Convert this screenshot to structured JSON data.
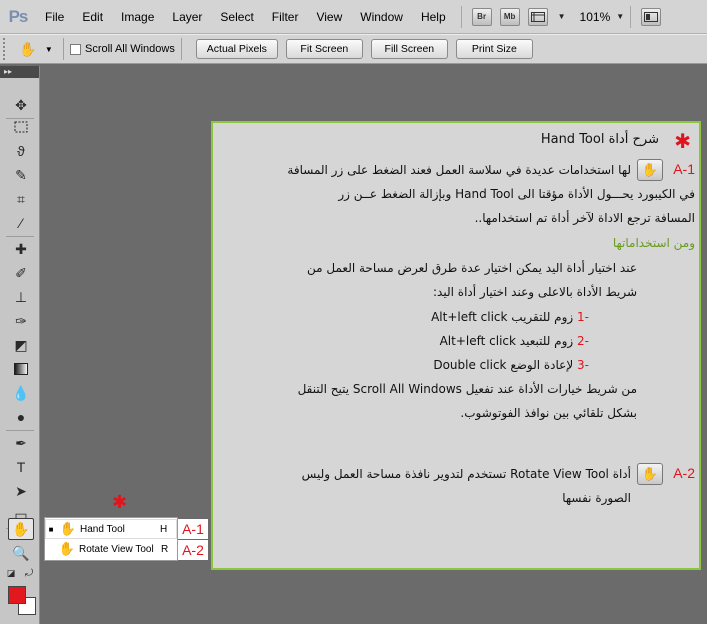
{
  "app": {
    "logo": "Ps"
  },
  "menu": [
    "File",
    "Edit",
    "Image",
    "Layer",
    "Select",
    "Filter",
    "View",
    "Window",
    "Help"
  ],
  "menu_badges": [
    "Br",
    "Mb"
  ],
  "zoom": "101%",
  "options": {
    "scroll_all_windows": "Scroll All Windows",
    "buttons": [
      "Actual Pixels",
      "Fit Screen",
      "Fill Screen",
      "Print Size"
    ]
  },
  "toolbar_header": "▸▸",
  "flyout": {
    "star": "✱",
    "items": [
      {
        "name": "Hand Tool",
        "key": "H",
        "tag": "A-1"
      },
      {
        "name": "Rotate View Tool",
        "key": "R",
        "tag": "A-2"
      }
    ]
  },
  "panel": {
    "star": "✱",
    "title": "شرح أداة Hand Tool",
    "a1_tag": "A-1",
    "a1_lines": [
      "لها استخدامات عديدة في سلاسة العمل فعند الضغط على زر المسافة",
      "في الكيبورد يحـــول الأداة مؤقتا الى Hand Tool وبإزالة الضغط عــن زر",
      "المسافة ترجع الاداة لآخر أداة تم استخدامها.."
    ],
    "uses_heading": "ومن استخداماتها",
    "uses_intro": [
      "عند اختيار أداة اليد يمكن اختيار عدة طرق لعرض مساحة العمل من",
      "شريط الأداة بالاعلى وعند اختيار أداة اليد:"
    ],
    "uses_items": [
      {
        "num": "-1",
        "text": "زوم للتقريب Alt+left click"
      },
      {
        "num": "-2",
        "text": "زوم للتبعيد Alt+left click"
      },
      {
        "num": "-3",
        "text": "لإعادة الوضع Double click"
      }
    ],
    "scroll_lines": [
      "من شريط خيارات الأداة عند تفعيل Scroll All Windows يتيح التنقل",
      "بشكل تلقائي بين نوافذ الفوتوشوب."
    ],
    "a2_tag": "A-2",
    "a2_lines": [
      "أداة Rotate View Tool تستخدم لتدوير نافذة مساحة العمل وليس",
      "الصورة نفسها"
    ]
  }
}
